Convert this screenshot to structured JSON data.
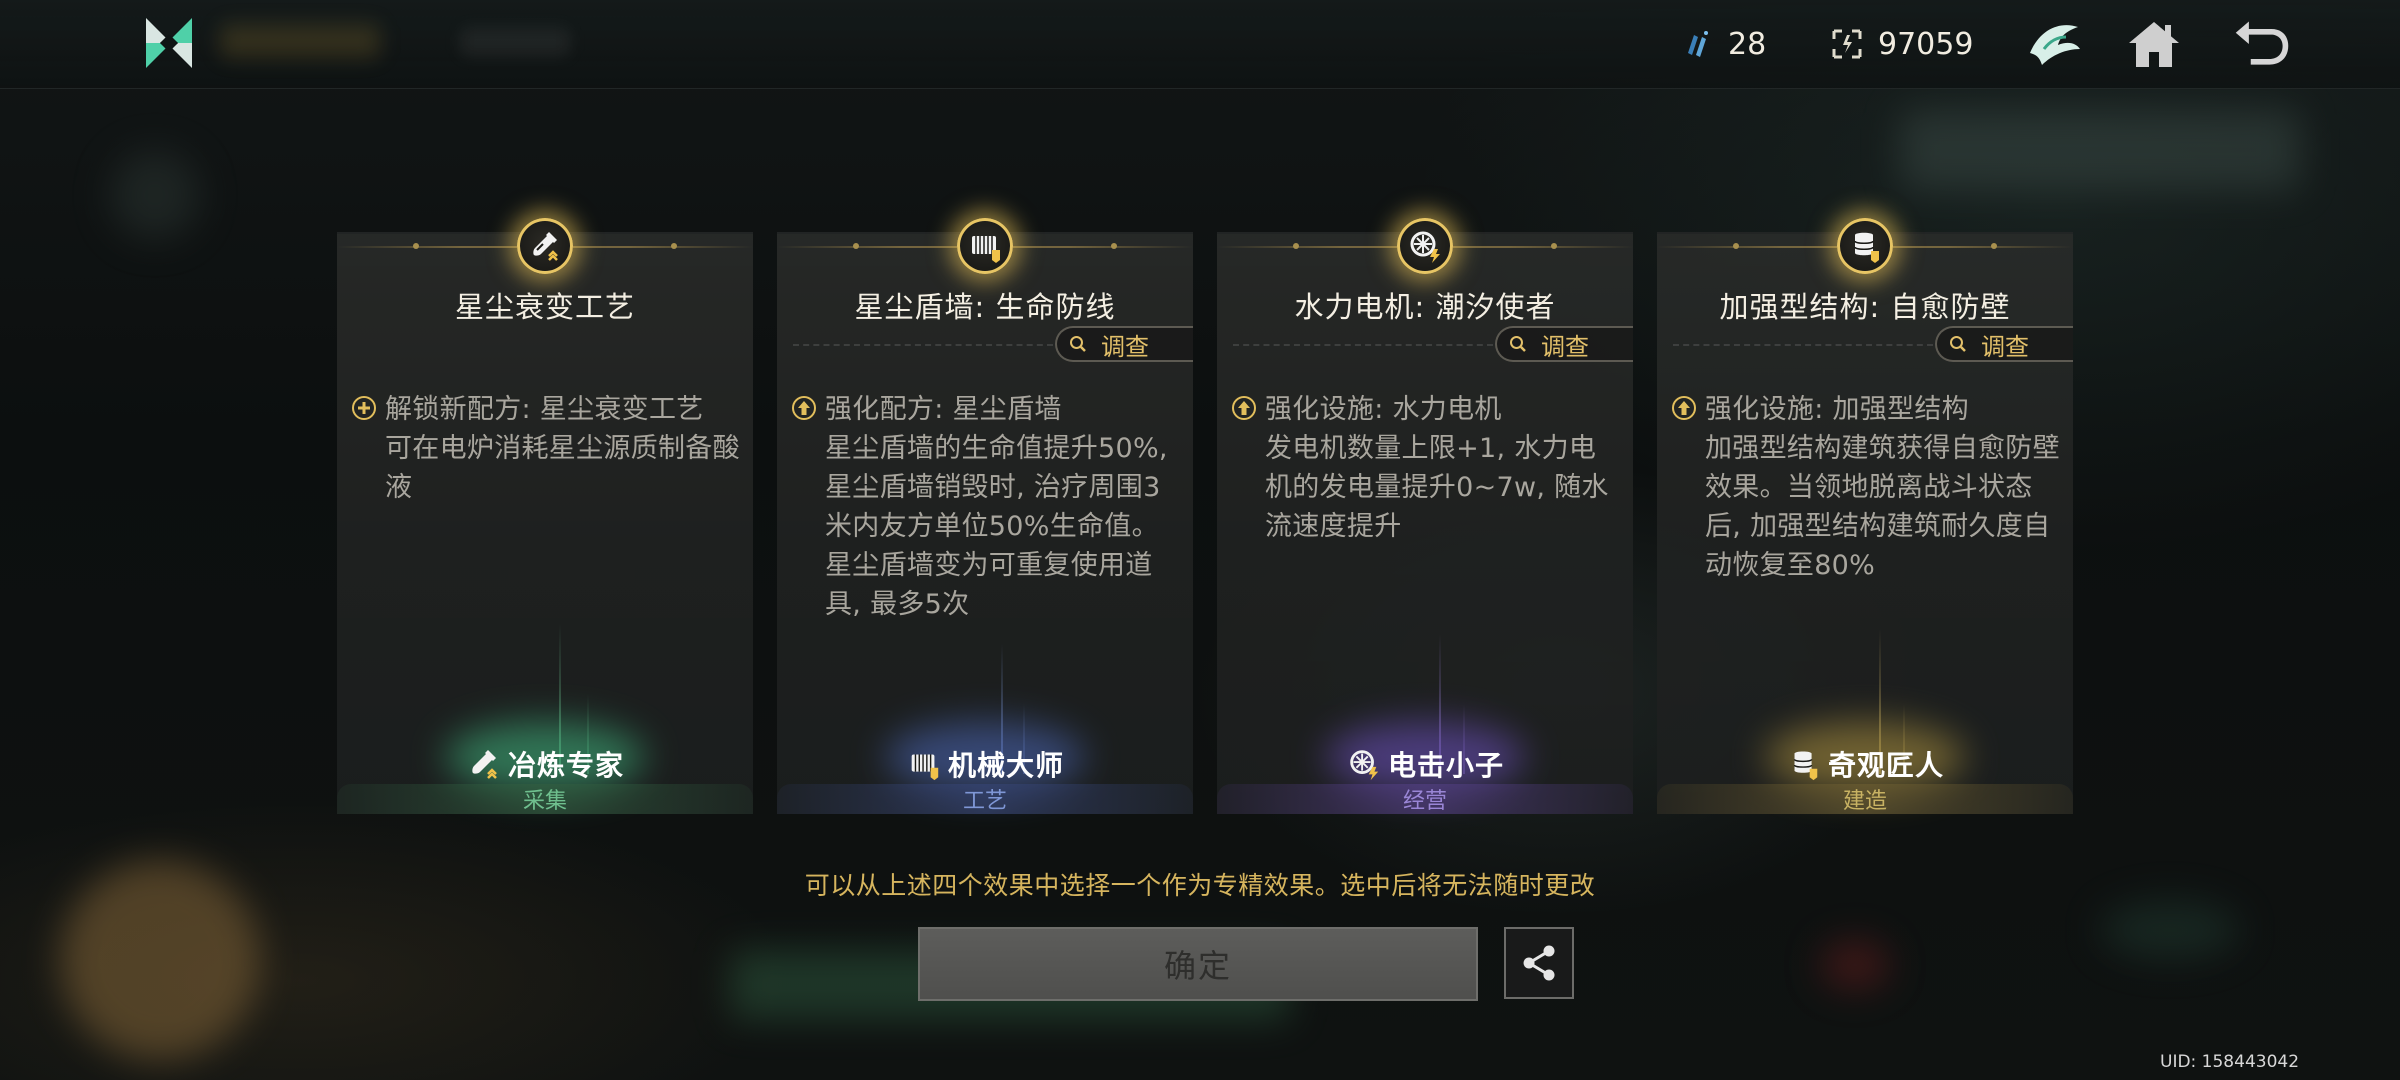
{
  "topbar": {
    "shards": "28",
    "coins": "97059",
    "icons": [
      "logo-icon",
      "shard-icon",
      "coin-icon",
      "emblem-icon",
      "home-icon",
      "back-icon"
    ]
  },
  "cards": [
    {
      "title": "星尘衰变工艺",
      "probe_label": "",
      "effect_head": "解锁新配方: 星尘衰变工艺",
      "effect_body": "可在电炉消耗星尘源质制备酸液",
      "role": "冶炼专家",
      "category": "采集",
      "accent": "#58c28a"
    },
    {
      "title": "星尘盾墙: 生命防线",
      "probe_label": "调查",
      "effect_head": "强化配方: 星尘盾墙",
      "effect_body": "星尘盾墙的生命值提升50%, 星尘盾墙销毁时, 治疗周围3米内友方单位50%生命值。星尘盾墙变为可重复使用道具, 最多5次",
      "role": "机械大师",
      "category": "工艺",
      "accent": "#6f8bd8"
    },
    {
      "title": "水力电机: 潮汐使者",
      "probe_label": "调查",
      "effect_head": "强化设施: 水力电机",
      "effect_body": "发电机数量上限+1, 水力电机的发电量提升0~7w, 随水流速度提升",
      "role": "电击小子",
      "category": "经营",
      "accent": "#8a70d6"
    },
    {
      "title": "加强型结构: 自愈防壁",
      "probe_label": "调查",
      "effect_head": "强化设施: 加强型结构",
      "effect_body": "加强型结构建筑获得自愈防壁效果。当领地脱离战斗状态后, 加强型结构建筑耐久度自动恢复至80%",
      "role": "奇观匠人",
      "category": "建造",
      "accent": "#c9b25a"
    }
  ],
  "notice": "可以从上述四个效果中选择一个作为专精效果。选中后将无法随时更改",
  "confirm_label": "确定",
  "uid": "UID: 158443042"
}
